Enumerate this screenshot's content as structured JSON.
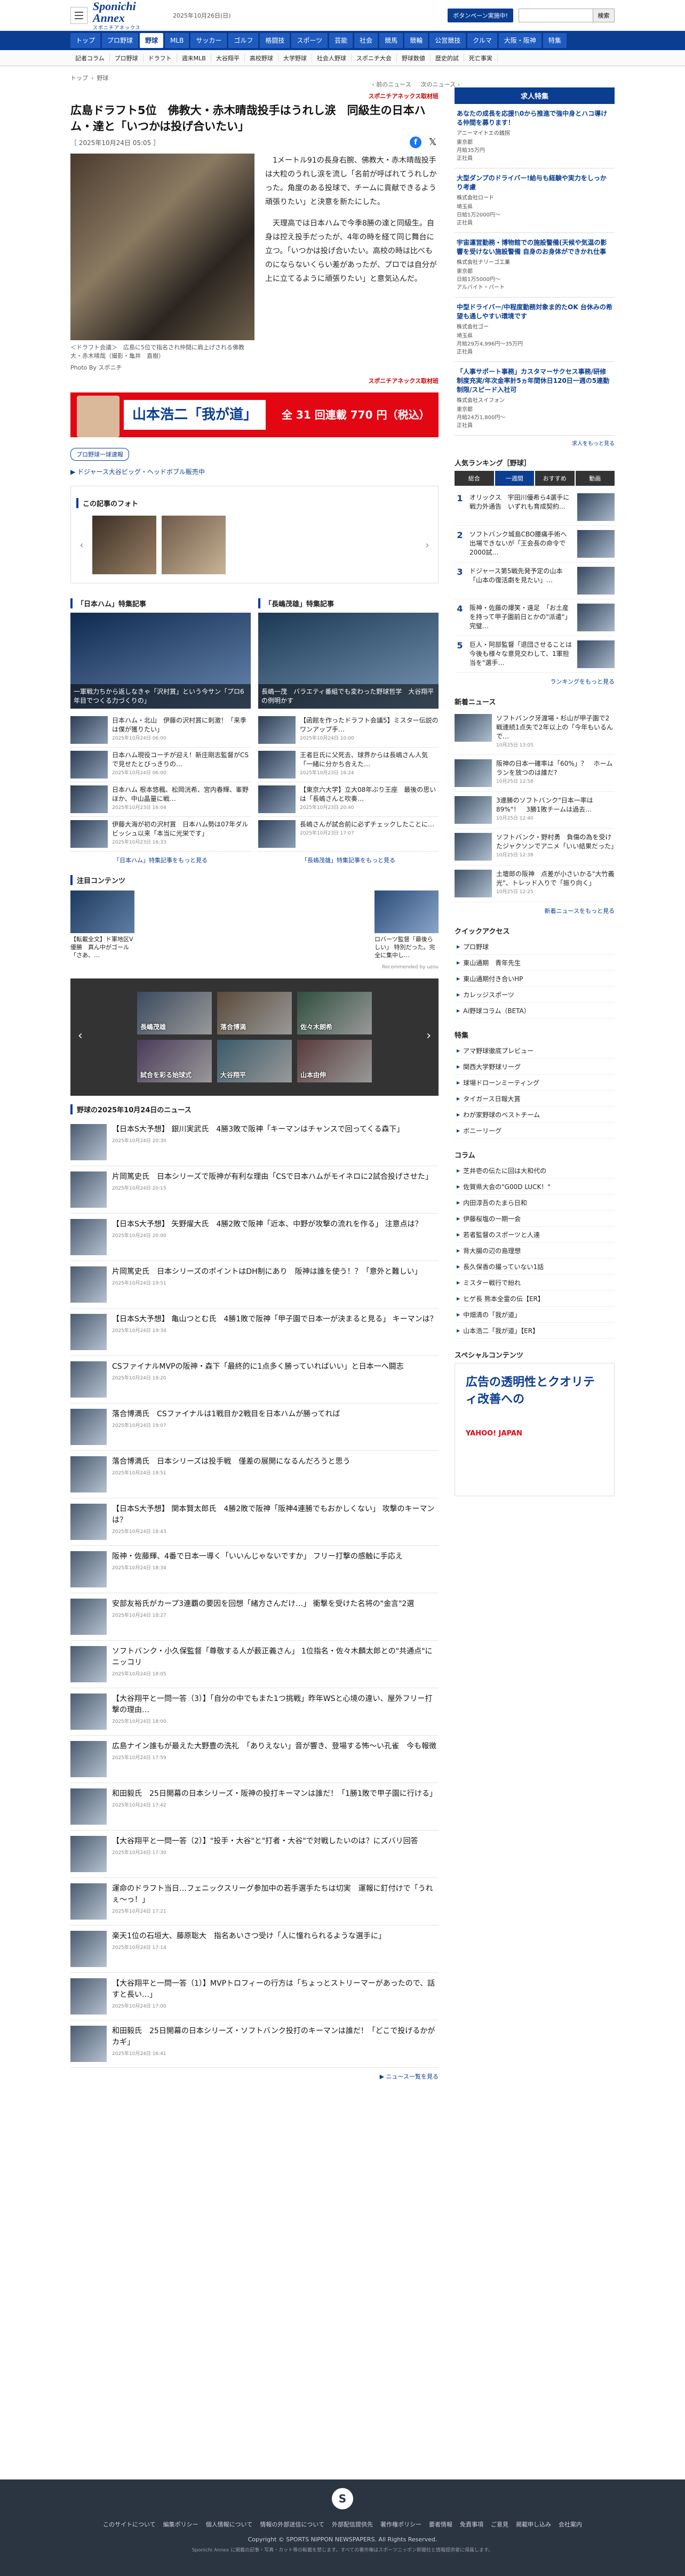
{
  "header": {
    "logo": "Sponichi Annex",
    "logo_sub": "スポニチアネックス",
    "date": "2025年10月26日(日)",
    "campaign": "ボタンペーン実施中!",
    "search_placeholder": "",
    "search_button": "検索"
  },
  "nav_main": [
    "トップ",
    "プロ野球",
    "野球",
    "MLB",
    "サッカー",
    "ゴルフ",
    "格闘技",
    "スポーツ",
    "芸能",
    "社会",
    "競馬",
    "競輪",
    "公営競技",
    "クルマ",
    "大阪・阪神",
    "特集"
  ],
  "nav_main_active": 2,
  "nav_sub": [
    "記者コラム",
    "プロ野球",
    "ドラフト",
    "週末MLB",
    "大谷翔平",
    "高校野球",
    "大学野球",
    "社会人野球",
    "スポニチ大会",
    "野球数値",
    "歴史的試",
    "死亡事実"
  ],
  "breadcrumb": [
    "トップ",
    "野球"
  ],
  "prev_next": {
    "prev": "前のニュース",
    "next": "次のニュース"
  },
  "article": {
    "provider": "スポニチアネックス取材班",
    "title": "広島ドラフト5位　佛教大・赤木晴哉投手はうれし涙　同級生の日本ハム・達と「いつかは投げ合いたい」",
    "date": "2025年10月24日 05:05",
    "photo_caption": "＜ドラフト会議＞　広島に5位で指名され仲間に肩上げされる佛教大・赤木晴哉（撮影・亀井　直樹）",
    "photo_credit": "Photo By スポニチ",
    "paragraphs": [
      "1メートル91の長身右腕、佛教大・赤木晴哉投手は大粒のうれし涙を流し「名前が呼ばれてうれしかった。角度のある投球で、チームに貢献できるよう頑張りたい」と決意を新たにした。",
      "天理高では日本ハムで今季8勝の達と同級生。自身は控え投手だったが、4年の時を経て同じ舞台に立つ。「いつかは投げ合いたい。高校の時は比べものにならないくらい差があったが、プロでは自分が上に立てるように頑張りたい」と意気込んだ。"
    ],
    "provider2": "スポニチアネックス取材班"
  },
  "banner": {
    "name": "山本浩二「我が道」",
    "promo": "全 31 回連載 770 円（税込）"
  },
  "tag": "プロ野球一球速報",
  "related_link": "ドジャース大谷ビッグ・ヘッドボブル販売中",
  "photos_section": "この記事のフォト",
  "feature": {
    "left_head": "「日本ハム」特集記事",
    "right_head": "「長嶋茂雄」特集記事",
    "left_main": "一軍戦力ちから返しなきゃ「沢村賞」という今サン「プロ6年目でつくる力づくりの」",
    "right_main": "長嶋一茂　バラエティ番組でも変わった野球哲学　大谷翔平の例明かす",
    "left_items": [
      {
        "t": "日本ハム・北山　伊藤の沢村賞に刺激！「来季は僕が獲りたい」",
        "d": "2025年10月24日 06:00"
      },
      {
        "t": "日本ハム現役コーチが迎え！新庄剛志監督がCSで見せたとびっきりの…",
        "d": "2025年10月24日 06:00"
      },
      {
        "t": "日本ハム 根本悠楓、松岡洸希、宮内春輝、峯野ほか、中山晶量に戦…",
        "d": "2025年10月23日 16:04"
      },
      {
        "t": "伊藤大海が初の沢村賞　日本ハム勢は07年ダルビッシュ以来「本当に光栄です」",
        "d": "2025年10月23日 16:33"
      }
    ],
    "right_items": [
      {
        "t": "【函館を作ったドラフト会議5】ミスター伝説のワンアップ手…",
        "d": "2025年10月24日 10:00"
      },
      {
        "t": "王者巨氏に父死去、球界からは長嶋さん人気「一緒に分かち合えた…",
        "d": "2025年10月23日 16:24"
      },
      {
        "t": "【東京六大学】立大08年ぶり王座　最後の思いは「長嶋さんと吹奏…",
        "d": "2025年10月23日 20:40"
      },
      {
        "t": "長嶋さんが試合前に必ずチェックしたことに…",
        "d": "2025年10月23日 17:07"
      }
    ],
    "left_more": "「日本ハム」特集記事をもっと見る",
    "right_more": "「長嶋茂雄」特集記事をもっと見る"
  },
  "attention": {
    "head": "注目コンテンツ",
    "items": [
      "【転載全文】ド軍地区V優勝　真ん中がゴール「さあ、…",
      "ロバーツ監督「最後らしい」 特別だった。完全に集中し…"
    ],
    "brand": "Recommended by uzou"
  },
  "carousel": [
    "長嶋茂雄",
    "落合博満",
    "佐々木朗希",
    "試合を彩る始球式",
    "大谷翔平",
    "山本由伸"
  ],
  "list_head": "野球の2025年10月24日のニュース",
  "list": [
    {
      "t": "【日本S大予想】 銀川実武氏　4勝3敗で阪神「キーマンはチャンスで回ってくる森下」",
      "d": "2025年10月24日 20:30"
    },
    {
      "t": "片岡篤史氏　日本シリーズで阪神が有利な理由「CSで日本ハムがモイネロに2試合投げさせた」",
      "d": "2025年10月24日 20:15"
    },
    {
      "t": "【日本S大予想】 矢野燿大氏　4勝2敗で阪神「近本、中野が攻撃の流れを作る」 注意点は？",
      "d": "2025年10月24日 20:00"
    },
    {
      "t": "片岡篤史氏　日本シリーズのポイントはDH制にあり　阪神は誰を使う！？「意外と難しい」",
      "d": "2025年10月24日 19:51"
    },
    {
      "t": "【日本S大予想】 亀山つとむ氏　4勝1敗で阪神「甲子園で日本一が決まると見る」 キーマンは？",
      "d": "2025年10月24日 19:34"
    },
    {
      "t": "CSファイナルMVPの阪神・森下「最終的に1点多く勝っていればいい」と日本一へ闘志",
      "d": "2025年10月24日 19:20"
    },
    {
      "t": "落合博満氏　CSファイナルは1戦目か2戦目を日本ハムが勝ってれば",
      "d": "2025年10月24日 19:07"
    },
    {
      "t": "落合博満氏　日本シリーズは投手戦　僅差の展開になるんだろうと思う",
      "d": "2025年10月24日 18:51"
    },
    {
      "t": "【日本S大予想】 関本賢太郎氏　4勝2敗で阪神「阪神4連勝でもおかしくない」 攻撃のキーマンは？",
      "d": "2025年10月24日 18:43"
    },
    {
      "t": "阪神・佐藤輝、4番で日本一導く「いいんじゃないですか」 フリー打撃の感触に手応え",
      "d": "2025年10月24日 18:34"
    },
    {
      "t": "安部友裕氏がカープ3連覇の要因を回想「緒方さんだけ…」 衝撃を受けた名将の\"金言\"2選",
      "d": "2025年10月24日 18:27"
    },
    {
      "t": "ソフトバンク・小久保監督「尊敬する人が薮正義さん」 1位指名・佐々木麟太郎との\"共通点\"にニッコリ",
      "d": "2025年10月24日 18:05"
    },
    {
      "t": "【大谷翔平と一問一答（3）】「自分の中でもまた1つ挑戦」昨年WSと心境の違い、屋外フリー打撃の理由…",
      "d": "2025年10月24日 18:00"
    },
    {
      "t": "広島ナイン誰もが最えた大野豊の洗礼　「ありえない」音が響き、登場する怖〜い孔雀　今も報徴",
      "d": "2025年10月24日 17:59"
    },
    {
      "t": "和田毅氏　25日開幕の日本シリーズ・阪神の投打キーマンは誰だ！「1勝1敗で甲子園に行ける」",
      "d": "2025年10月24日 17:42"
    },
    {
      "t": "【大谷翔平と一問一答（2）】\"投手・大谷\"と\"打者・大谷\"で対戦したいのは？にズバリ回答",
      "d": "2025年10月24日 17:30"
    },
    {
      "t": "運命のドラフト当日…フェニックスリーグ参加中の若手選手たちは切実　運報に釘付けで「うれぇ〜っ！」",
      "d": "2025年10月24日 17:21"
    },
    {
      "t": "楽天1位の石垣大、藤原聡大　指名あいさつ受け「人に憧れられるような選手に」",
      "d": "2025年10月24日 17:14"
    },
    {
      "t": "【大谷翔平と一問一答（1）】MVPトロフィーの行方は「ちょっとストリーマーがあったので、話すと長い…」",
      "d": "2025年10月24日 17:00"
    },
    {
      "t": "和田毅氏　25日開幕の日本シリーズ・ソフトバンク投打のキーマンは誰だ！「どこで投げるかがカギ」",
      "d": "2025年10月24日 16:41"
    }
  ],
  "list_more": "ニュース一覧を見る",
  "side": {
    "job_head": "求人特集",
    "jobs": [
      {
        "t": "あなたの成長を応援!\\0から推進で強中身とハコ導ける仲間を募ります！",
        "c": "アニーマイトエの銭拐",
        "m": "東京都\n月給35万円\n正社員"
      },
      {
        "t": "大型ダンプのドライバー!給与も経験や実力をしっかり考慮",
        "c": "株式会社ロード",
        "m": "埼玉県\n日給1万2000円〜\n正社員"
      },
      {
        "t": "宇宙運営勤務・博物館での施設警備(天候や気温の影響を受けない施設警備 自身のお身体ができかれ仕事",
        "c": "株式会社ナリーゴ工業",
        "m": "東京都\n日給1万5000円〜\nアルバイト・パート"
      },
      {
        "t": "中型ドライバー/中程度勤務対象ま的たOK 台休みの希望も通しやすい環境です",
        "c": "株式会社ゴー",
        "m": "埼玉県\n月給29万4,996円〜35万円\n正社員"
      },
      {
        "t": "「人事サポート事務」カスタマーサクセス事務/研修制度充実/年次金率計5ヵ年間休日120日一週の5連勤制限/スピード入社可",
        "c": "株式会社スイフォン",
        "m": "東京都\n月給24万1,800円〜\n正社員"
      }
    ],
    "job_more": "求人をもっと見る",
    "rank_head": "人気ランキング［野球］",
    "rank_tabs": [
      "総合",
      "一週間",
      "おすすめ",
      "動画"
    ],
    "ranks": [
      {
        "n": "1",
        "t": "オリックス　宇田川優希ら4選手に戦力外通告　いずれも育成契約…"
      },
      {
        "n": "2",
        "t": "ソフトバンク城島CBO腰痛手術へ 出場できないが「王会長の命令で2000試…"
      },
      {
        "n": "3",
        "t": "ドジャース第5戦先発予定の山本「山本の復活劇を見たい」…"
      },
      {
        "n": "4",
        "t": "阪神・佐藤の爆笑・遠足　「お土産を持って甲子園前日とかの\"派遣\"」 完璧…"
      },
      {
        "n": "5",
        "t": "巨人・阿部監督「退団させることは今後も様々な意見交わして、1軍担当を\"選手…"
      }
    ],
    "rank_more": "ランキングをもっと見る",
    "new_head": "新着ニュース",
    "news": [
      {
        "t": "ソフトバンク牙渡場・杉山が甲子園で2戦連続1点失で2年以上の「今年もいるんで…",
        "d": "10月25日 13:05"
      },
      {
        "t": "阪神の日本一確率は「60%」？　ホームランを放つのは誰だ?",
        "d": "10月25日 12:58"
      },
      {
        "t": "3連勝のソフトバンク\"日本一率は89%\"！　3勝1敗チームは過去…",
        "d": "10月25日 12:40"
      },
      {
        "t": "ソフトバンク・野村勇　負傷の為を受けたジャクソンでアニメ「いい結果だった」",
        "d": "10月25日 12:38"
      },
      {
        "t": "土壇郎の阪神　点差が小さいかる\"大竹義光\"、トレッド入りで「振り向く」",
        "d": "10月25日 12:25"
      }
    ],
    "new_more": "新着ニュースをもっと見る",
    "qa_head": "クイックアクセス",
    "qa": [
      "プロ野球",
      "東山通期　青年先生",
      "東山通期付き合いHP",
      "カレッジスポーツ",
      "Ai野球コラム（BETA）"
    ],
    "feat_head": "特集",
    "feats": [
      "アマ野球徹底プレビュー",
      "関西大学野球リーグ",
      "球場ドローンミーティング",
      "タイガース日報大賞",
      "わが家野球のベストチーム",
      "ボニーリーグ"
    ],
    "col_head": "コラム",
    "cols": [
      "芝井壱の伝たに回は大和代の",
      "佐賀県大会の\"G00D LUCK！\"",
      "内田淳吾のたまら日和",
      "伊藤桜塩の一期一会",
      "若者監督のスポーツと人達",
      "背大腸の辺の島理想",
      "長久保香の撮っていない1話",
      "ミスター戦行で紛れ",
      "ヒゲ長 熊本全霊の伝【ER】",
      "中畑清の「我が道」",
      "山本浩二「我が道」【ER】"
    ],
    "sp_head": "スペシャルコンテンツ",
    "ad_text": "広告の透明性とクオリティ改善への",
    "ad_brand": "YAHOO! JAPAN"
  },
  "footer": {
    "logo": "S",
    "links": [
      "このサイトについて",
      "編集ポリシー",
      "個人情報について",
      "情報の外部送信について",
      "外部配信提供先",
      "著作権ポリシー",
      "要者情報",
      "免責事項",
      "ご意見",
      "掲載申し込み",
      "会社案内"
    ],
    "copy": "Copyright © SPORTS NIPPON NEWSPAPERS. All Rights Reserved.",
    "note": "Sponichi Annex に掲載の記事・写真・カット等の転載を禁じます。すべての著作権はスポーツニッポン新聞社と情報提供者に帰属します。"
  }
}
